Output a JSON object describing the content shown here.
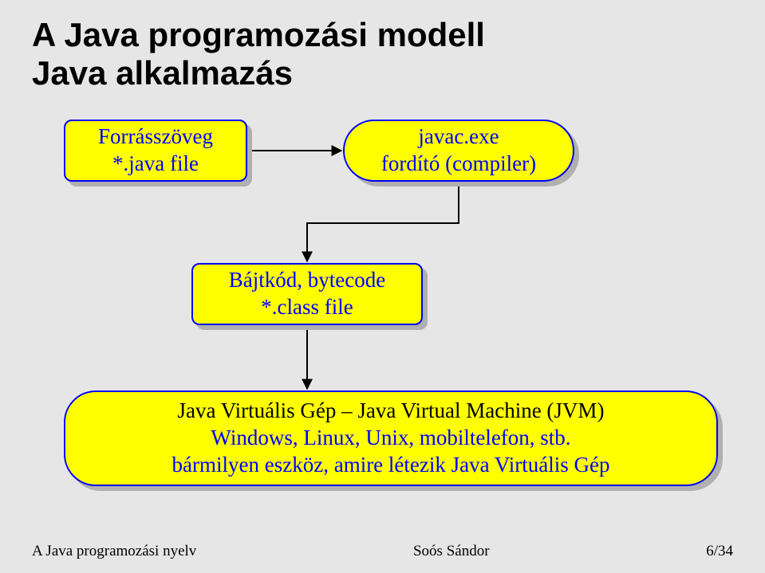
{
  "title": {
    "line1": "A Java programozási modell",
    "line2": "Java alkalmazás"
  },
  "nodes": {
    "source": {
      "l1": "Forrásszöveg",
      "l2": "*.java file"
    },
    "compiler": {
      "l1": "javac.exe",
      "l2": "fordító (compiler)"
    },
    "bytecode": {
      "l1": "Bájtkód, bytecode",
      "l2": "*.class file"
    },
    "jvm": {
      "l1": "Java Virtuális Gép – Java Virtual Machine (JVM)",
      "l2": "Windows, Linux, Unix, mobiltelefon, stb.",
      "l3": "bármilyen eszköz, amire létezik Java Virtuális Gép"
    }
  },
  "footer": {
    "left": "A Java programozási nyelv",
    "center": "Soós Sándor",
    "right": "6/34"
  },
  "chart_data": {
    "type": "diagram",
    "title": "A Java programozási modell – Java alkalmazás",
    "nodes": [
      {
        "id": "source",
        "label": "Forrásszöveg *.java file",
        "shape": "rounded-rect"
      },
      {
        "id": "compiler",
        "label": "javac.exe fordító (compiler)",
        "shape": "ellipse"
      },
      {
        "id": "bytecode",
        "label": "Bájtkód, bytecode *.class file",
        "shape": "rounded-rect"
      },
      {
        "id": "jvm",
        "label": "Java Virtuális Gép – Java Virtual Machine (JVM); Windows, Linux, Unix, mobiltelefon, stb.; bármilyen eszköz, amire létezik Java Virtuális Gép",
        "shape": "stadium"
      }
    ],
    "edges": [
      {
        "from": "source",
        "to": "compiler"
      },
      {
        "from": "compiler",
        "to": "bytecode"
      },
      {
        "from": "bytecode",
        "to": "jvm"
      }
    ]
  }
}
